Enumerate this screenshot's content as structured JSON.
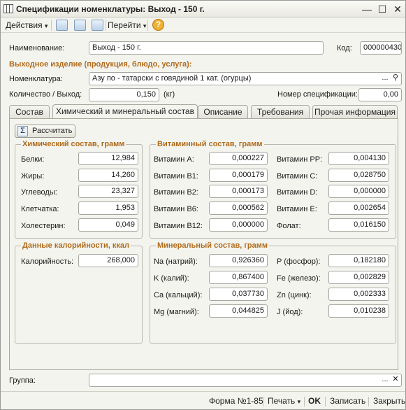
{
  "window": {
    "title": "Спецификации номенклатуры: Выход - 150 г.",
    "minimize_glyph": "—",
    "maximize_glyph": "☐",
    "close_glyph": "✕"
  },
  "toolbar": {
    "actions_label": "Действия",
    "goto_label": "Перейти",
    "help_glyph": "?",
    "dropdown_glyph": "▾"
  },
  "form": {
    "name_label": "Наименование:",
    "name_value": "Выход - 150 г.",
    "code_label": "Код:",
    "code_value": "000000430",
    "output_section_title": "Выходное изделие (продукция, блюдо, услуга):",
    "nomenclature_label": "Номенклатура:",
    "nomenclature_value": "Азу по - татарски с говядиной 1 кат. (огурцы)",
    "quantity_label": "Количество / Выход:",
    "quantity_value": "0,150",
    "unit_label": "(кг)",
    "spec_number_label": "Номер спецификации:",
    "spec_number_value": "0,00",
    "ellipsis_glyph": "...",
    "search_glyph": "⚲",
    "clear_glyph": "✕"
  },
  "tabs": [
    {
      "label": "Состав"
    },
    {
      "label": "Химический и минеральный состав"
    },
    {
      "label": "Описание"
    },
    {
      "label": "Требования"
    },
    {
      "label": "Прочая информация"
    }
  ],
  "calculate_button": {
    "label": "Рассчитать",
    "icon_glyph": "Σ"
  },
  "chemical": {
    "title": "Химический состав, грамм",
    "rows": [
      {
        "label": "Белки:",
        "value": "12,984"
      },
      {
        "label": "Жиры:",
        "value": "14,260"
      },
      {
        "label": "Углеводы:",
        "value": "23,327"
      },
      {
        "label": "Клетчатка:",
        "value": "1,953"
      },
      {
        "label": "Холестерин:",
        "value": "0,049"
      }
    ]
  },
  "vitamins": {
    "title": "Витаминный состав, грамм",
    "left": [
      {
        "label": "Витамин А:",
        "value": "0,000227"
      },
      {
        "label": "Витамин B1:",
        "value": "0,000179"
      },
      {
        "label": "Витамин B2:",
        "value": "0,000173"
      },
      {
        "label": "Витамин B6:",
        "value": "0,000562"
      },
      {
        "label": "Витамин B12:",
        "value": "0,000000"
      }
    ],
    "right": [
      {
        "label": "Витамин PP:",
        "value": "0,004130"
      },
      {
        "label": "Витамин С:",
        "value": "0,028750"
      },
      {
        "label": "Витамин D:",
        "value": "0,000000"
      },
      {
        "label": "Витамин Е:",
        "value": "0,002654"
      },
      {
        "label": "Фолат:",
        "value": "0,016150"
      }
    ]
  },
  "calories": {
    "title": "Данные калорийности, ккал",
    "label": "Калорийность:",
    "value": "268,000"
  },
  "minerals": {
    "title": "Минеральный состав, грамм",
    "left": [
      {
        "label": "Na (натрий):",
        "value": "0,926360"
      },
      {
        "label": "K (калий):",
        "value": "0,867400"
      },
      {
        "label": "Ca (кальций):",
        "value": "0,037730"
      },
      {
        "label": "Mg (магний):",
        "value": "0,044825"
      }
    ],
    "right": [
      {
        "label": "P (фосфор):",
        "value": "0,182180"
      },
      {
        "label": "Fe (железо):",
        "value": "0,002829"
      },
      {
        "label": "Zn (цинк):",
        "value": "0,002333"
      },
      {
        "label": "J (йод):",
        "value": "0,010238"
      }
    ]
  },
  "group": {
    "label": "Группа:",
    "value": ""
  },
  "footer": {
    "form_label": "Форма №1-85",
    "print_label": "Печать",
    "ok_label": "OK",
    "save_label": "Записать",
    "close_label": "Закрыть"
  }
}
